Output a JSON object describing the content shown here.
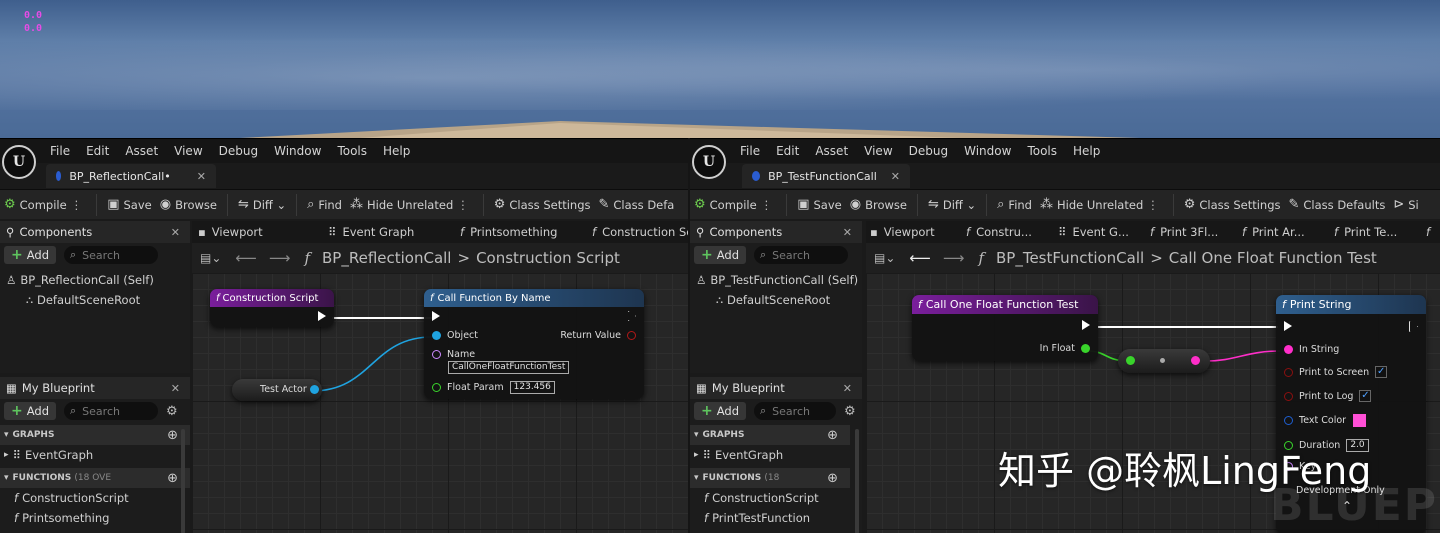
{
  "viewport": {
    "debug_lines": [
      "0.0",
      "0.0"
    ]
  },
  "menus": [
    "File",
    "Edit",
    "Asset",
    "View",
    "Debug",
    "Window",
    "Tools",
    "Help"
  ],
  "logo_text": "U",
  "left": {
    "tab_title": "BP_ReflectionCall•",
    "toolbar": {
      "compile": "Compile",
      "save": "Save",
      "browse": "Browse",
      "diff": "Diff",
      "find": "Find",
      "hide_unrelated": "Hide Unrelated",
      "class_settings": "Class Settings",
      "class_defaults": "Class Defa"
    },
    "components": {
      "title": "Components",
      "add": "Add",
      "search_placeholder": "Search",
      "root": "BP_ReflectionCall (Self)",
      "child": "DefaultSceneRoot"
    },
    "my_blueprint": {
      "title": "My Blueprint",
      "add": "Add",
      "search_placeholder": "Search",
      "graphs_label": "GRAPHS",
      "event_graph": "EventGraph",
      "functions_label": "FUNCTIONS",
      "functions_count": "(18 OVE",
      "fn1": "ConstructionScript",
      "fn2": "Printsomething"
    },
    "editor_tabs": [
      "Viewport",
      "Event Graph",
      "Printsomething",
      "Construction Sc"
    ],
    "breadcrumb": {
      "root": "BP_ReflectionCall",
      "sep": ">",
      "current": "Construction Script"
    },
    "nodes": {
      "construction": {
        "title": "Construction Script"
      },
      "call": {
        "title": "Call Function By Name",
        "object": "Object",
        "return_value": "Return Value",
        "name_label": "Name",
        "name_value": "CallOneFloatFunctionTest",
        "float_label": "Float Param",
        "float_value": "123.456"
      },
      "actor": {
        "title": "Test Actor"
      }
    }
  },
  "right": {
    "tab_title": "BP_TestFunctionCall",
    "toolbar": {
      "compile": "Compile",
      "save": "Save",
      "browse": "Browse",
      "diff": "Diff",
      "find": "Find",
      "hide_unrelated": "Hide Unrelated",
      "class_settings": "Class Settings",
      "class_defaults": "Class Defaults",
      "extra": "Si"
    },
    "components": {
      "title": "Components",
      "add": "Add",
      "search_placeholder": "Search",
      "root": "BP_TestFunctionCall (Self)",
      "child": "DefaultSceneRoot"
    },
    "my_blueprint": {
      "title": "My Blueprint",
      "add": "Add",
      "search_placeholder": "Search",
      "graphs_label": "GRAPHS",
      "event_graph": "EventGraph",
      "functions_label": "FUNCTIONS",
      "functions_count": "(18",
      "fn1": "ConstructionScript",
      "fn2": "PrintTestFunction"
    },
    "editor_tabs": [
      "Viewport",
      "Constru...",
      "Event G...",
      "Print 3Fl...",
      "Print Ar...",
      "Print Te..."
    ],
    "breadcrumb": {
      "root": "BP_TestFunctionCall",
      "sep": ">",
      "current": "Call One Float Function Test"
    },
    "nodes": {
      "entry": {
        "title": "Call One Float Function Test",
        "in_float": "In Float"
      },
      "print": {
        "title": "Print String",
        "in_string": "In String",
        "print_screen": "Print to Screen",
        "print_log": "Print to Log",
        "text_color": "Text Color",
        "duration": "Duration",
        "duration_value": "2.0",
        "key": "Key",
        "dev_only": "Development Only"
      }
    }
  },
  "watermark": "知乎 @聆枫LingFeng",
  "blueprint_watermark": "BLUEPR",
  "colors": {
    "exec": "#ffffff",
    "object_pin": "#1fa3e0",
    "string_pin": "#ff2ec9",
    "float_pin": "#39d42b",
    "name_pin": "#cc88ff",
    "struct_pin": "#1e5fd1",
    "purple_header": "#7a1e9c",
    "blue_header": "#2f5f8e",
    "text_color_swatch": "#ff4fd6"
  }
}
